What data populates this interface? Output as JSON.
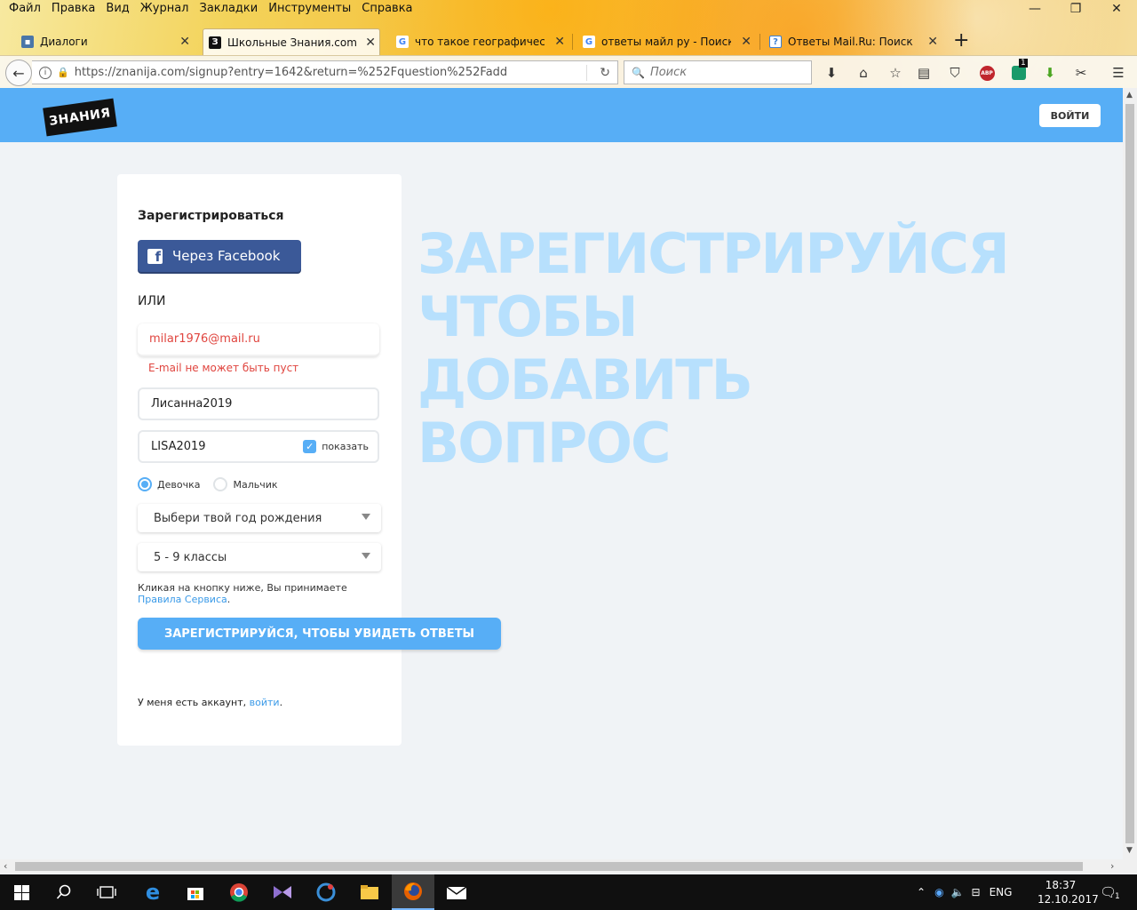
{
  "browser": {
    "menu": [
      "Файл",
      "Правка",
      "Вид",
      "Журнал",
      "Закладки",
      "Инструменты",
      "Справка"
    ],
    "window_controls": {
      "minimize": "—",
      "restore": "❐",
      "close": "✕"
    },
    "tabs": [
      {
        "title": "Диалоги",
        "active": false,
        "favicon_color": "#4a76a8",
        "favicon_glyph": "▪"
      },
      {
        "title": "Школьные Знания.com - Р",
        "active": true,
        "favicon_color": "#111111",
        "favicon_glyph": "З"
      },
      {
        "title": "что такое географический",
        "active": false,
        "favicon_color": "#4285f4",
        "favicon_glyph": "G"
      },
      {
        "title": "ответы майл ру - Поиск в",
        "active": false,
        "favicon_color": "#4285f4",
        "favicon_glyph": "G"
      },
      {
        "title": "Ответы Mail.Ru: Поиск",
        "active": false,
        "favicon_color": "#3a7fd5",
        "favicon_glyph": "?"
      }
    ],
    "url": "https://znanija.com/signup?entry=1642&return=%252Fquestion%252Fadd",
    "search_placeholder": "Поиск",
    "toolbar_badge": "1"
  },
  "site": {
    "logo_text": "ЗНАНИЯ",
    "login_button": "ВОЙТИ"
  },
  "signup": {
    "title": "Зарегистрироваться",
    "facebook_button": "Через Facebook",
    "or_label": "ИЛИ",
    "email_value": "milar1976@mail.ru",
    "email_error": "E-mail не может быть пуст",
    "nick_value": "Лисанна2019",
    "password_value": "LISA2019",
    "show_password_label": "показать",
    "show_password_checked": true,
    "gender_options": [
      "Девочка",
      "Мальчик"
    ],
    "gender_selected": "Девочка",
    "birth_year_select": "Выбери твой год рождения",
    "grade_select": "5 - 9 классы",
    "terms_text": "Кликая на кнопку ниже, Вы принимаете",
    "terms_link": "Правила Сервиса",
    "terms_end": ".",
    "submit_button": "ЗАРЕГИСТРИРУЙСЯ, ЧТОБЫ УВИДЕТЬ ОТВЕТЫ",
    "have_account_text": "У меня есть аккаунт,",
    "have_account_link": "войти",
    "have_account_end": "."
  },
  "hero": {
    "lines": [
      "ЗАРЕГИСТРИРУЙСЯ",
      "ЧТОБЫ",
      "ДОБАВИТЬ",
      "ВОПРОС"
    ]
  },
  "taskbar": {
    "language": "ENG",
    "time": "18:37",
    "date": "12.10.2017",
    "notifications": "1"
  },
  "colors": {
    "brand_blue": "#57aef6",
    "facebook_blue": "#3b5998",
    "error_red": "#e0453f",
    "hero_text": "#b7e0fd"
  }
}
